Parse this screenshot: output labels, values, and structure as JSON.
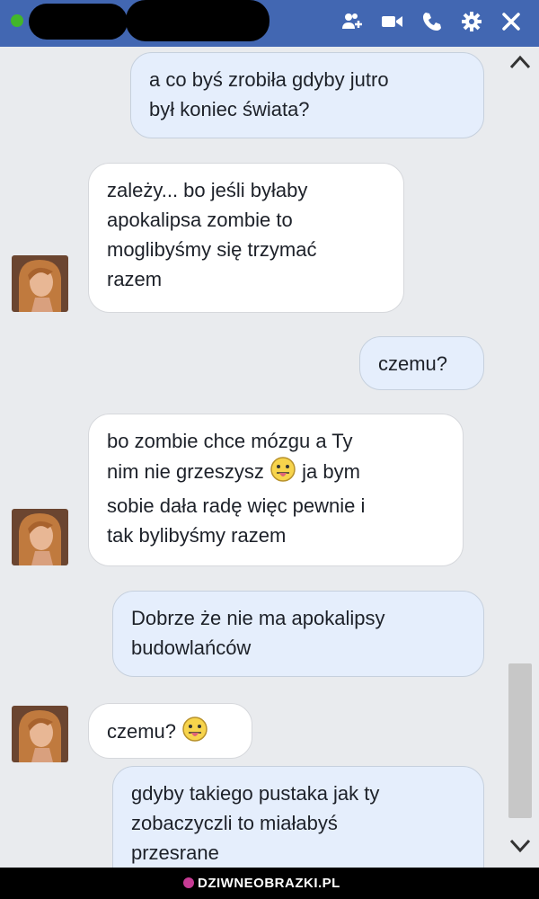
{
  "header": {
    "icons": [
      "add-people-icon",
      "video-call-icon",
      "phone-icon",
      "gear-icon",
      "close-icon"
    ],
    "status_color": "#42b72a",
    "bar_color": "#4267b2"
  },
  "messages": [
    {
      "from": "me",
      "lines": [
        "a co byś zrobiła gdyby jutro",
        "był koniec świata?"
      ]
    },
    {
      "from": "them",
      "lines": [
        "zależy... bo jeśli byłaby",
        "apokalipsa zombie to",
        "moglibyśmy się trzymać",
        "razem"
      ]
    },
    {
      "from": "me",
      "lines": [
        "czemu?"
      ]
    },
    {
      "from": "them",
      "line1": "bo zombie chce mózgu a Ty",
      "line2_a": "nim nie grzeszysz",
      "line2_b": "ja bym",
      "line3": "sobie dała radę więc pewnie i",
      "line4": "tak bylibyśmy razem",
      "emoji": "tongue-out-emoji"
    },
    {
      "from": "me",
      "lines": [
        "Dobrze że nie ma apokalipsy",
        "budowlańców"
      ]
    },
    {
      "from": "them",
      "text": "czemu?",
      "emoji": "tongue-out-emoji"
    },
    {
      "from": "me",
      "lines": [
        "gdyby takiego pustaka  jak ty",
        "zobaczyczli to miałabyś",
        "przesrane"
      ]
    }
  ],
  "watermark": "DZIWNEOBRAZKI.PL"
}
